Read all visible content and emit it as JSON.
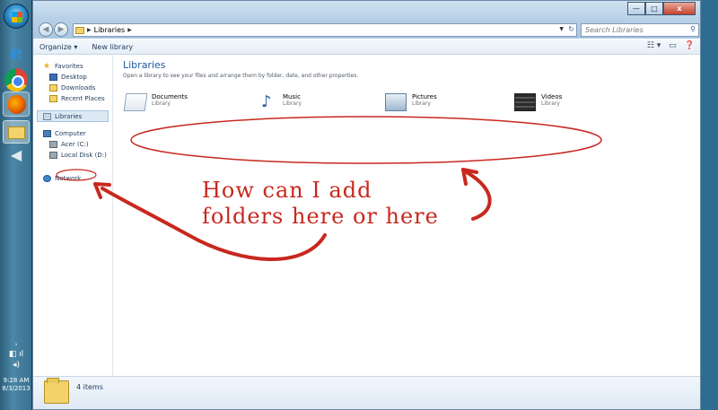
{
  "taskbar": {
    "icons": [
      "start-orb",
      "ie-icon",
      "chrome-icon",
      "firefox-icon",
      "explorer-icon",
      "camera-icon"
    ],
    "clock_time": "9:28 AM",
    "clock_date": "8/3/2013"
  },
  "window": {
    "controls": {
      "minimize": "—",
      "maximize": "□",
      "close": "x"
    },
    "address": {
      "crumb": "Libraries"
    },
    "search": {
      "placeholder": "Search Libraries"
    },
    "toolbar": {
      "organize": "Organize ▾",
      "new_library": "New library"
    }
  },
  "sidebar": {
    "favorites": "Favorites",
    "desktop": "Desktop",
    "downloads": "Downloads",
    "recent_places": "Recent Places",
    "libraries": "Libraries",
    "computer": "Computer",
    "acer": "Acer (C:)",
    "local_disk": "Local Disk (D:)",
    "network": "Network"
  },
  "content": {
    "title": "Libraries",
    "subtitle": "Open a library to see your files and arrange them by folder, date, and other properties.",
    "libraries": [
      {
        "name": "Documents",
        "type": "Library"
      },
      {
        "name": "Music",
        "type": "Library"
      },
      {
        "name": "Pictures",
        "type": "Library"
      },
      {
        "name": "Videos",
        "type": "Library"
      }
    ]
  },
  "statusbar": {
    "text": "4 items"
  },
  "annotation": {
    "line1": "How can I add",
    "line2": "folders here or here",
    "color": "#c8281e"
  }
}
